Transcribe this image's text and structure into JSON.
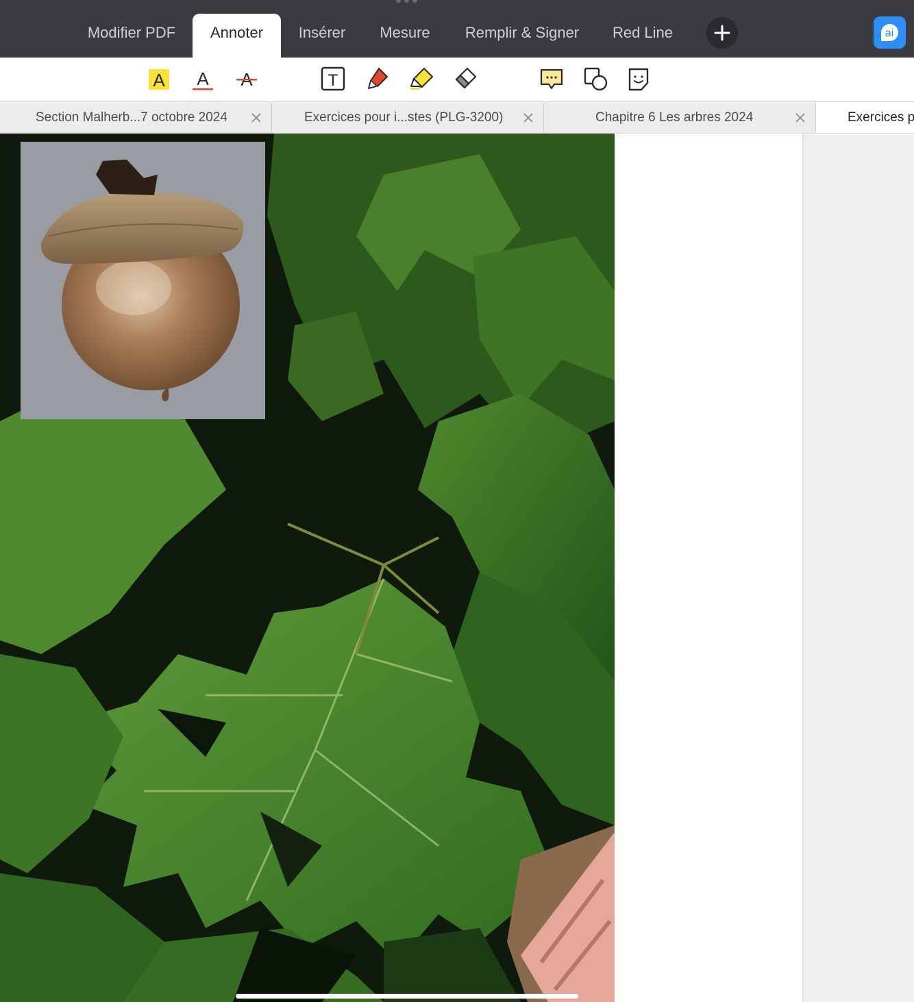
{
  "main_tabs": [
    {
      "label": "Modifier PDF",
      "active": false
    },
    {
      "label": "Annoter",
      "active": true
    },
    {
      "label": "Insérer",
      "active": false
    },
    {
      "label": "Mesure",
      "active": false
    },
    {
      "label": "Remplir & Signer",
      "active": false
    },
    {
      "label": "Red Line",
      "active": false
    }
  ],
  "ai_button": {
    "label": "ai"
  },
  "toolbar": {
    "tools": [
      {
        "icon": "highlight-text-icon",
        "glyph": "A"
      },
      {
        "icon": "underline-text-icon",
        "glyph": "A"
      },
      {
        "icon": "strikethrough-text-icon",
        "glyph": "A"
      },
      {
        "icon": "text-box-icon",
        "glyph": "T"
      },
      {
        "icon": "pen-icon"
      },
      {
        "icon": "highlighter-icon"
      },
      {
        "icon": "eraser-icon"
      },
      {
        "icon": "comment-icon"
      },
      {
        "icon": "shapes-icon"
      },
      {
        "icon": "sticker-icon"
      }
    ]
  },
  "doc_tabs": [
    {
      "label": "Section Malherb...7 octobre 2024",
      "active": false
    },
    {
      "label": "Exercices pour i...stes (PLG-3200)",
      "active": false
    },
    {
      "label": "Chapitre 6 Les arbres  2024",
      "active": false
    },
    {
      "label": "Exercices p",
      "active": true
    }
  ],
  "colors": {
    "topbar": "#3a3b40",
    "accent_ai": "#2d8ef5",
    "highlight_yellow": "#f7e23a",
    "underline_red": "#e0452e"
  }
}
